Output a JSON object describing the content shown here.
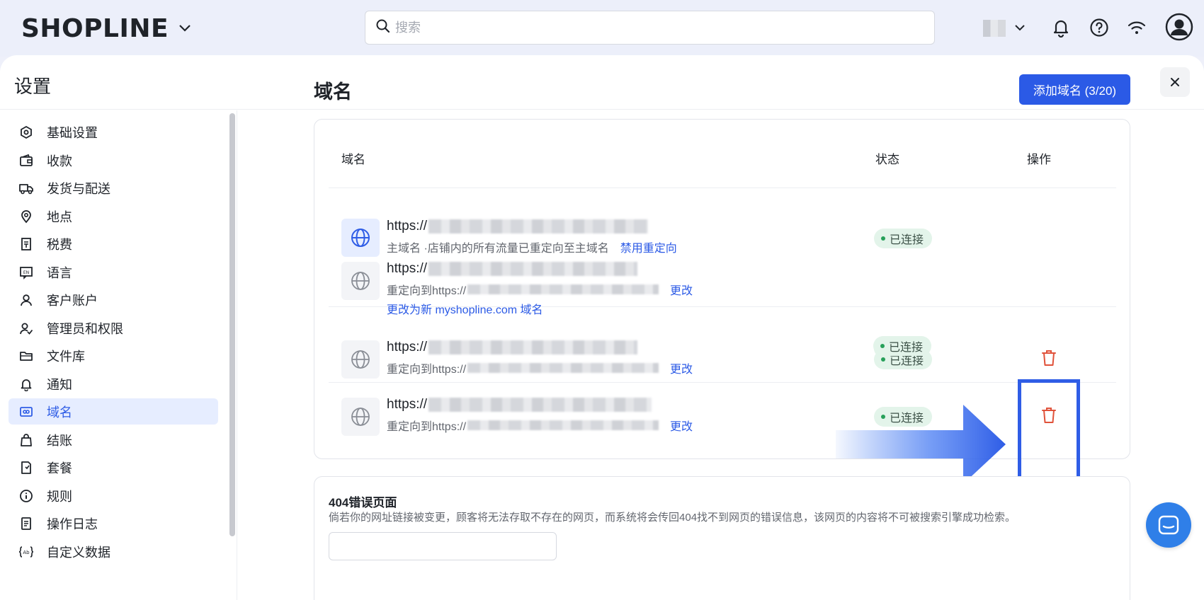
{
  "app": {
    "logo": "SHOPLINE"
  },
  "search": {
    "placeholder": "搜索"
  },
  "panel": {
    "title": "设置"
  },
  "sidebar": {
    "items": [
      {
        "label": "基础设置",
        "icon": "hexagon-settings-icon"
      },
      {
        "label": "收款",
        "icon": "wallet-icon"
      },
      {
        "label": "发货与配送",
        "icon": "truck-icon"
      },
      {
        "label": "地点",
        "icon": "location-pin-icon"
      },
      {
        "label": "税费",
        "icon": "receipt-icon"
      },
      {
        "label": "语言",
        "icon": "language-icon"
      },
      {
        "label": "客户账户",
        "icon": "user-icon"
      },
      {
        "label": "管理员和权限",
        "icon": "user-permission-icon"
      },
      {
        "label": "文件库",
        "icon": "folder-icon"
      },
      {
        "label": "通知",
        "icon": "bell-icon"
      },
      {
        "label": "域名",
        "icon": "domain-icon",
        "active": true
      },
      {
        "label": "结账",
        "icon": "bag-icon"
      },
      {
        "label": "套餐",
        "icon": "plan-icon"
      },
      {
        "label": "规则",
        "icon": "info-circle-icon"
      },
      {
        "label": "操作日志",
        "icon": "log-icon"
      },
      {
        "label": "自定义数据",
        "icon": "custom-data-icon"
      }
    ]
  },
  "main": {
    "title": "域名",
    "add_button": "添加域名 (3/20)",
    "table": {
      "headers": {
        "domain": "域名",
        "status": "状态",
        "actions": "操作"
      },
      "rows": [
        {
          "url_prefix": "https://",
          "sub_text": "主域名 ·店铺内的所有流量已重定向至主域名",
          "sub_link": "禁用重定向",
          "status": "已连接",
          "primary": true
        },
        {
          "url_prefix": "https://",
          "sub_text": "重定向到https://",
          "sub_link": "更改",
          "extra_link": "更改为新 myshopline.com 域名",
          "status": "已连接"
        },
        {
          "url_prefix": "https://",
          "sub_text": "重定向到https://",
          "sub_link": "更改",
          "status": "已连接",
          "deletable": true
        },
        {
          "url_prefix": "https://",
          "sub_text": "重定向到https://",
          "sub_link": "更改",
          "status": "已连接",
          "deletable": true
        }
      ]
    }
  },
  "error_page": {
    "title": "404错误页面",
    "description": "倘若你的网址链接被变更，顾客将无法存取不存在的网页，而系统将会传回404找不到网页的错误信息，该网页的内容将不可被搜索引擎成功检索。"
  },
  "colors": {
    "accent": "#2b5ae6",
    "success": "#27a05a",
    "danger": "#e0523a"
  }
}
